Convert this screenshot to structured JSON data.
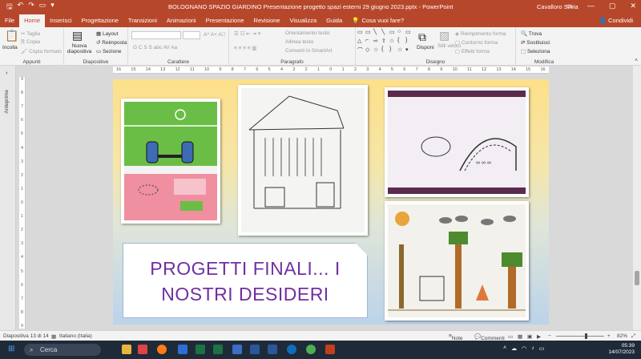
{
  "window": {
    "title": "BOLOGNANO SPAZIO GIARDINO Presentazione progetto spazi esterni 29 giugno 2023.pptx  -  PowerPoint",
    "user": "Cavalloro Silvia"
  },
  "tabs": [
    "File",
    "Home",
    "Inserisci",
    "Progettazione",
    "Transizioni",
    "Animazioni",
    "Presentazione",
    "Revisione",
    "Visualizza",
    "Guida"
  ],
  "tell_me": "Cosa vuoi fare?",
  "share": "Condividi",
  "ribbon": {
    "clipboard": {
      "label": "Appunti",
      "paste": "Incolla",
      "cut": "Taglia",
      "copy": "Copia",
      "format": "Copia formato"
    },
    "slides": {
      "label": "Diapositive",
      "new": "Nuova diapositiva",
      "layout": "Layout",
      "reset": "Reimposta",
      "section": "Sezione"
    },
    "font": {
      "label": "Carattere",
      "buttons": "G  C  S  S  abc  AV  Aa"
    },
    "paragraph": {
      "label": "Paragrafo",
      "orient": "Orientamento testo",
      "align": "Allinea testo",
      "smartart": "Converti in SmartArt"
    },
    "drawing": {
      "label": "Disegno",
      "arrange": "Disponi",
      "styles": "Stili veloci",
      "fill": "Riempimento forma",
      "outline": "Contorno forma",
      "effects": "Effetti forma"
    },
    "editing": {
      "label": "Modifica",
      "find": "Trova",
      "replace": "Sostituisci",
      "select": "Seleziona"
    }
  },
  "left_pane": "Anteprime",
  "ruler": {
    "h": [
      "16",
      "15",
      "14",
      "13",
      "12",
      "11",
      "10",
      "9",
      "8",
      "7",
      "6",
      "5",
      "4",
      "3",
      "2",
      "1",
      "0",
      "1",
      "2",
      "3",
      "4",
      "5",
      "6",
      "7",
      "8",
      "9",
      "10",
      "11",
      "12",
      "13",
      "14",
      "15",
      "16"
    ],
    "v": [
      "9",
      "8",
      "7",
      "6",
      "5",
      "4",
      "3",
      "2",
      "1",
      "0",
      "1",
      "2",
      "3",
      "4",
      "5",
      "6",
      "7",
      "8",
      "9"
    ]
  },
  "slide": {
    "line1": "PROGETTI FINALI... I",
    "line2": "NOSTRI DESIDERI"
  },
  "status": {
    "slide": "Diapositiva 13 di 14",
    "lang": "Italiano (Italia)",
    "notes": "Note",
    "comments": "Commenti",
    "zoom": "82%"
  },
  "taskbar": {
    "search": "Cerca",
    "time": "05:39",
    "date": "14/07/2023"
  }
}
